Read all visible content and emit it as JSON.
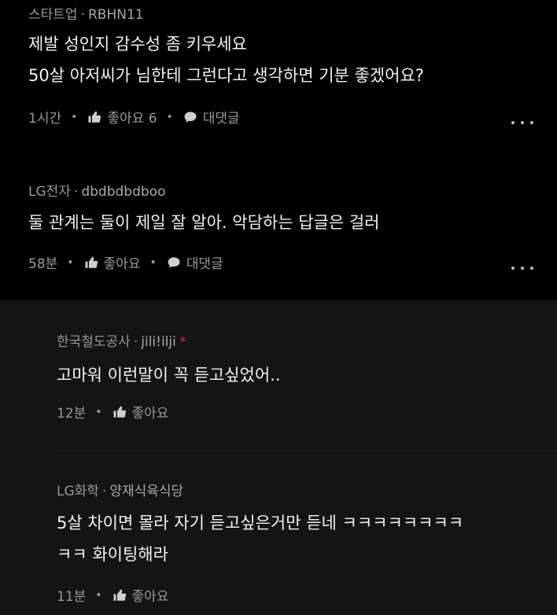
{
  "comments": [
    {
      "company": "스타트업",
      "nickname": "RBHN11",
      "lines": [
        "제발 성인지 감수성 좀 키우세요",
        "50살 아저씨가 님한테 그런다고 생각하면 기분 좋겠어요?"
      ],
      "time": "1시간",
      "like_label": "좋아요 6",
      "reply_label": "대댓글"
    },
    {
      "company": "LG전자",
      "nickname": "dbdbdbdboo",
      "lines": [
        "둘 관계는 둘이 제일 잘 알아. 악담하는 답글은 걸러"
      ],
      "time": "58분",
      "like_label": "좋아요",
      "reply_label": "대댓글"
    }
  ],
  "replies": [
    {
      "company": "한국철도공사",
      "nickname": "jili!ilji",
      "author_mark": "*",
      "lines": [
        "고마워 이런말이 꼭 듣고싶었어.."
      ],
      "time": "12분",
      "like_label": "좋아요"
    },
    {
      "company": "LG화학",
      "nickname": "양재식육식당",
      "lines": [
        "5살 차이면 몰라 자기 듣고싶은거만 듣네 ㅋㅋㅋㅋㅋㅋㅋㅋ",
        "ㅋㅋ 화이팅해라"
      ],
      "time": "11분",
      "like_label": "좋아요"
    }
  ],
  "icons": {
    "like": "thumbs-up-icon",
    "reply": "speech-bubble-icon",
    "more": "more-dots-icon"
  },
  "colors": {
    "background": "#000000",
    "reply_background": "#141414",
    "author_mark": "#e0283b"
  }
}
